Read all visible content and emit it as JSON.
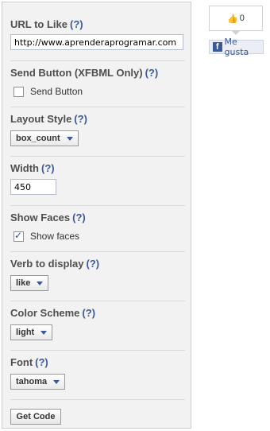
{
  "help_text": "(?)",
  "url_field": {
    "label": "URL to Like",
    "value": "http://www.aprenderaprogramar.com"
  },
  "send_button": {
    "label": "Send Button (XFBML Only)",
    "checkbox_label": "Send Button",
    "checked": false
  },
  "layout_style": {
    "label": "Layout Style",
    "selected": "box_count"
  },
  "width": {
    "label": "Width",
    "value": "450"
  },
  "show_faces": {
    "label": "Show Faces",
    "checkbox_label": "Show faces",
    "checked": true
  },
  "verb": {
    "label": "Verb to display",
    "selected": "like"
  },
  "color_scheme": {
    "label": "Color Scheme",
    "selected": "light"
  },
  "font": {
    "label": "Font",
    "selected": "tahoma"
  },
  "get_code_label": "Get Code",
  "preview": {
    "count": "0",
    "like_label": "Me gusta",
    "thumb_glyph": "👍",
    "logo_letter": "f"
  },
  "colors": {
    "accent": "#3b5998",
    "panel_bg": "#f2f2f2"
  }
}
